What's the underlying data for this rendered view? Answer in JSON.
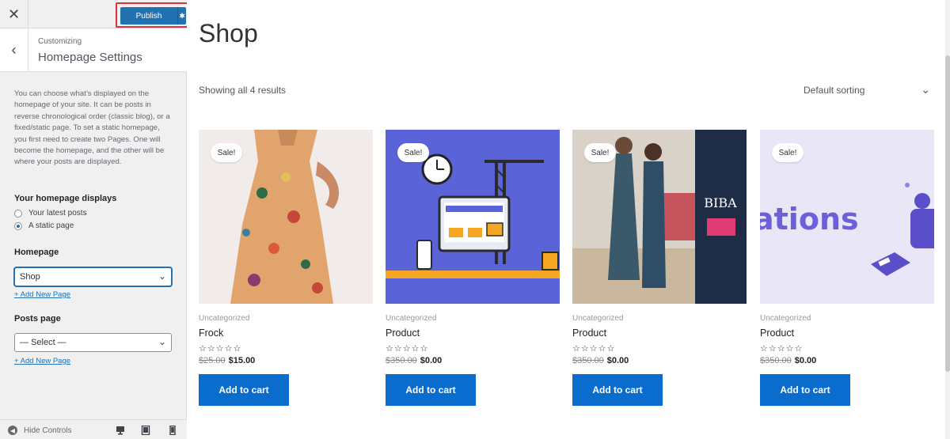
{
  "sidebar": {
    "close_icon_name": "close-icon",
    "publish_label": "Publish",
    "crumb": "Customizing",
    "section_title": "Homepage Settings",
    "description": "You can choose what’s displayed on the homepage of your site. It can be posts in reverse chronological order (classic blog), or a fixed/static page. To set a static homepage, you first need to create two Pages. One will become the homepage, and the other will be where your posts are displayed.",
    "displays_label": "Your homepage displays",
    "radio_options": [
      {
        "label": "Your latest posts",
        "selected": false
      },
      {
        "label": "A static page",
        "selected": true
      }
    ],
    "homepage_label": "Homepage",
    "homepage_value": "Shop",
    "add_new_page": "+ Add New Page",
    "posts_page_label": "Posts page",
    "posts_page_value": "— Select —",
    "hide_controls": "Hide Controls"
  },
  "shop": {
    "title": "Shop",
    "results": "Showing all 4 results",
    "sorting": "Default sorting",
    "sale_badge": "Sale!",
    "add_to_cart": "Add to cart",
    "products": [
      {
        "category": "Uncategorized",
        "name": "Frock",
        "old_price": "$25.00",
        "price": "$15.00",
        "rating": 0
      },
      {
        "category": "Uncategorized",
        "name": "Product",
        "old_price": "$350.00",
        "price": "$0.00",
        "rating": 0
      },
      {
        "category": "Uncategorized",
        "name": "Product",
        "old_price": "$350.00",
        "price": "$0.00",
        "rating": 0
      },
      {
        "category": "Uncategorized",
        "name": "Product",
        "old_price": "$350.00",
        "price": "$0.00",
        "rating": 0
      }
    ],
    "image_texts": {
      "biba": "BIBA",
      "banner_word": "ations"
    }
  },
  "colors": {
    "accent": "#2271b1",
    "cart_button": "#0a6ccc",
    "highlight_border": "#e0313b"
  }
}
